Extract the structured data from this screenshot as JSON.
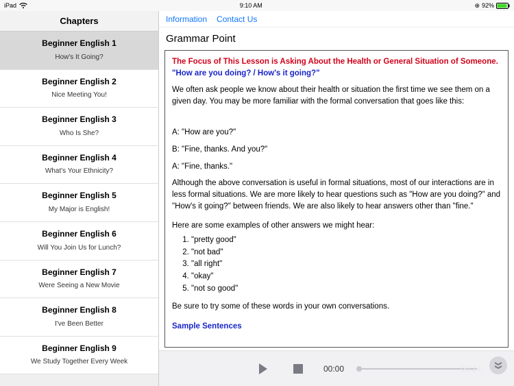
{
  "status": {
    "device": "iPad",
    "time": "9:10 AM",
    "battery_percent": "92%"
  },
  "sidebar": {
    "header": "Chapters",
    "items": [
      {
        "title": "Beginner English 1",
        "subtitle": "How's It Going?",
        "selected": true
      },
      {
        "title": "Beginner English 2",
        "subtitle": "Nice Meeting You!"
      },
      {
        "title": "Beginner English 3",
        "subtitle": "Who Is She?"
      },
      {
        "title": "Beginner English 4",
        "subtitle": "What's Your Ethnicity?"
      },
      {
        "title": "Beginner English 5",
        "subtitle": "My Major is English!"
      },
      {
        "title": "Beginner English 6",
        "subtitle": "Will You Join Us for Lunch?"
      },
      {
        "title": "Beginner English 7",
        "subtitle": "Were Seeing a New Movie"
      },
      {
        "title": "Beginner English 8",
        "subtitle": "I've Been Better"
      },
      {
        "title": "Beginner English 9",
        "subtitle": "We Study Together Every Week"
      }
    ]
  },
  "nav": {
    "information": "Information",
    "contact": "Contact Us"
  },
  "page_title": "Grammar Point",
  "lesson": {
    "focus": "The Focus of This Lesson is Asking About the Health or General Situation of Someone.",
    "phrase": "\"How are you doing? / How's it going?\"",
    "intro": "We often ask people we know about their health or situation the first time we see them on a given day. You may be more familiar with the formal conversation that goes like this:",
    "dialog": [
      "A: \"How are you?\"",
      "B: \"Fine, thanks. And you?\"",
      "A: \"Fine, thanks.\""
    ],
    "explain": "Although the above conversation is useful in formal situations, most of our interactions are in less formal situations. We are more likely to hear questions such as \"How are you doing?\" and \"How's it going?\" between friends. We are also likely to hear answers other than \"fine.\"",
    "examples_intro": "Here are some examples of other answers we might hear:",
    "examples": [
      "\"pretty good\"",
      "\"not bad\"",
      "\"all right\"",
      "\"okay\"",
      "\"not so good\""
    ],
    "closing": "Be sure to try some of these words in your own conversations.",
    "sample_link": "Sample Sentences"
  },
  "player": {
    "elapsed": "00:00",
    "duration": "00:24"
  }
}
